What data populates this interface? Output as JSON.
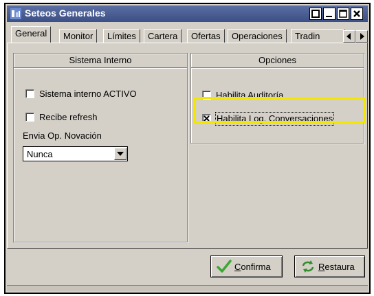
{
  "window": {
    "title": "Seteos Generales"
  },
  "tabs": [
    {
      "label": "General",
      "active": true
    },
    {
      "label": "Monitor"
    },
    {
      "label": "Límites"
    },
    {
      "label": "Cartera"
    },
    {
      "label": "Ofertas"
    },
    {
      "label": "Operaciones"
    },
    {
      "label": "Tradin"
    }
  ],
  "sistema_interno": {
    "title": "Sistema Interno",
    "activo": {
      "label": "Sistema interno ACTIVO",
      "checked": false
    },
    "refresh": {
      "label": "Recibe refresh",
      "checked": false
    },
    "novacion_label": "Envia Op. Novación",
    "novacion_value": "Nunca"
  },
  "opciones": {
    "title": "Opciones",
    "auditoria": {
      "label": "Habilita Auditoría",
      "checked": false
    },
    "log": {
      "label": "Habilita Log. Conversaciones",
      "checked": true
    }
  },
  "buttons": {
    "confirma": "Confirma",
    "restaura": "Restaura"
  },
  "colors": {
    "title_bar": "#3c4f86",
    "highlight": "#f3e600",
    "face": "#d4d0c8"
  },
  "icons": {
    "title": "app-icon",
    "confirma": "check-icon",
    "restaura": "refresh-icon"
  }
}
